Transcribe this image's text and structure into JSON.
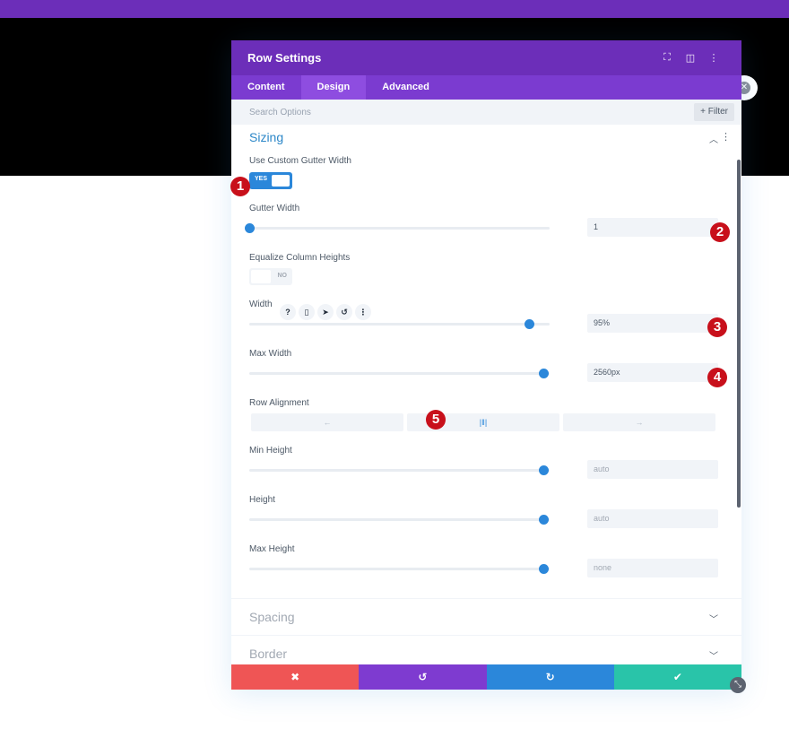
{
  "panel": {
    "title": "Row Settings",
    "header_icons": [
      "fullscreen-icon",
      "split-view-icon",
      "more-options-icon"
    ],
    "tabs": [
      {
        "label": "Content",
        "active": false
      },
      {
        "label": "Design",
        "active": true
      },
      {
        "label": "Advanced",
        "active": false
      }
    ],
    "search_placeholder": "Search Options",
    "filter_label": "+ Filter"
  },
  "sections": {
    "sizing": {
      "title": "Sizing",
      "use_custom_gutter": {
        "label": "Use Custom Gutter Width",
        "value": "YES"
      },
      "gutter_width": {
        "label": "Gutter Width",
        "value": "1",
        "slider_fraction": 0.0
      },
      "equalize": {
        "label": "Equalize Column Heights",
        "value": "NO"
      },
      "width": {
        "label": "Width",
        "value": "95%",
        "slider_fraction": 0.93
      },
      "max_width": {
        "label": "Max Width",
        "value": "2560px",
        "slider_fraction": 0.98
      },
      "row_alignment": {
        "label": "Row Alignment",
        "options": [
          "←",
          "|‖|",
          "→"
        ],
        "selected": 1
      },
      "min_height": {
        "label": "Min Height",
        "value": "auto",
        "slider_fraction": 0.98
      },
      "height": {
        "label": "Height",
        "value": "auto",
        "slider_fraction": 0.98
      },
      "max_height": {
        "label": "Max Height",
        "value": "none",
        "slider_fraction": 0.98
      }
    },
    "spacing": {
      "title": "Spacing"
    },
    "border": {
      "title": "Border"
    }
  },
  "width_icons": [
    "?",
    "▯",
    "➤",
    "↺",
    "⋮"
  ],
  "markers": [
    "1",
    "2",
    "3",
    "4",
    "5"
  ],
  "footer": {
    "cancel_icon": "✖",
    "undo_icon": "↺",
    "redo_icon": "↻",
    "save_icon": "✔"
  },
  "colors": {
    "purple": "#6c2eb9",
    "accent_blue": "#2b87da",
    "cancel_red": "#ef5555",
    "save_green": "#29c4a9"
  }
}
